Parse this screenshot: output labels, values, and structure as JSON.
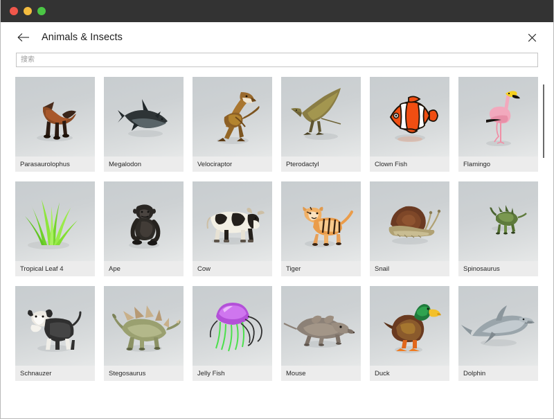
{
  "window": {
    "traffic_lights": [
      {
        "name": "close",
        "color": "#f1574b"
      },
      {
        "name": "minimize",
        "color": "#f4bc3f"
      },
      {
        "name": "zoom",
        "color": "#4bc645"
      }
    ]
  },
  "header": {
    "back_icon": "arrow-left-icon",
    "title": "Animals & Insects",
    "close_icon": "close-icon"
  },
  "search": {
    "placeholder": "搜索",
    "value": ""
  },
  "grid": {
    "columns": 6,
    "items": [
      {
        "label": "Parasaurolophus",
        "art": "parasaurolophus"
      },
      {
        "label": "Megalodon",
        "art": "megalodon"
      },
      {
        "label": "Velociraptor",
        "art": "velociraptor"
      },
      {
        "label": "Pterodactyl",
        "art": "pterodactyl"
      },
      {
        "label": "Clown Fish",
        "art": "clownfish"
      },
      {
        "label": "Flamingo",
        "art": "flamingo"
      },
      {
        "label": "Tropical Leaf 4",
        "art": "tropicalleaf"
      },
      {
        "label": "Ape",
        "art": "ape"
      },
      {
        "label": "Cow",
        "art": "cow"
      },
      {
        "label": "Tiger",
        "art": "tiger"
      },
      {
        "label": "Snail",
        "art": "snail"
      },
      {
        "label": "Spinosaurus",
        "art": "spinosaurus"
      },
      {
        "label": "Schnauzer",
        "art": "schnauzer"
      },
      {
        "label": "Stegosaurus",
        "art": "stegosaurus"
      },
      {
        "label": "Jelly Fish",
        "art": "jellyfish"
      },
      {
        "label": "Mouse",
        "art": "mouse"
      },
      {
        "label": "Duck",
        "art": "duck"
      },
      {
        "label": "Dolphin",
        "art": "dolphin"
      }
    ]
  },
  "scrollbar": {
    "orientation": "vertical",
    "thumb_color": "#6a6a6a"
  }
}
